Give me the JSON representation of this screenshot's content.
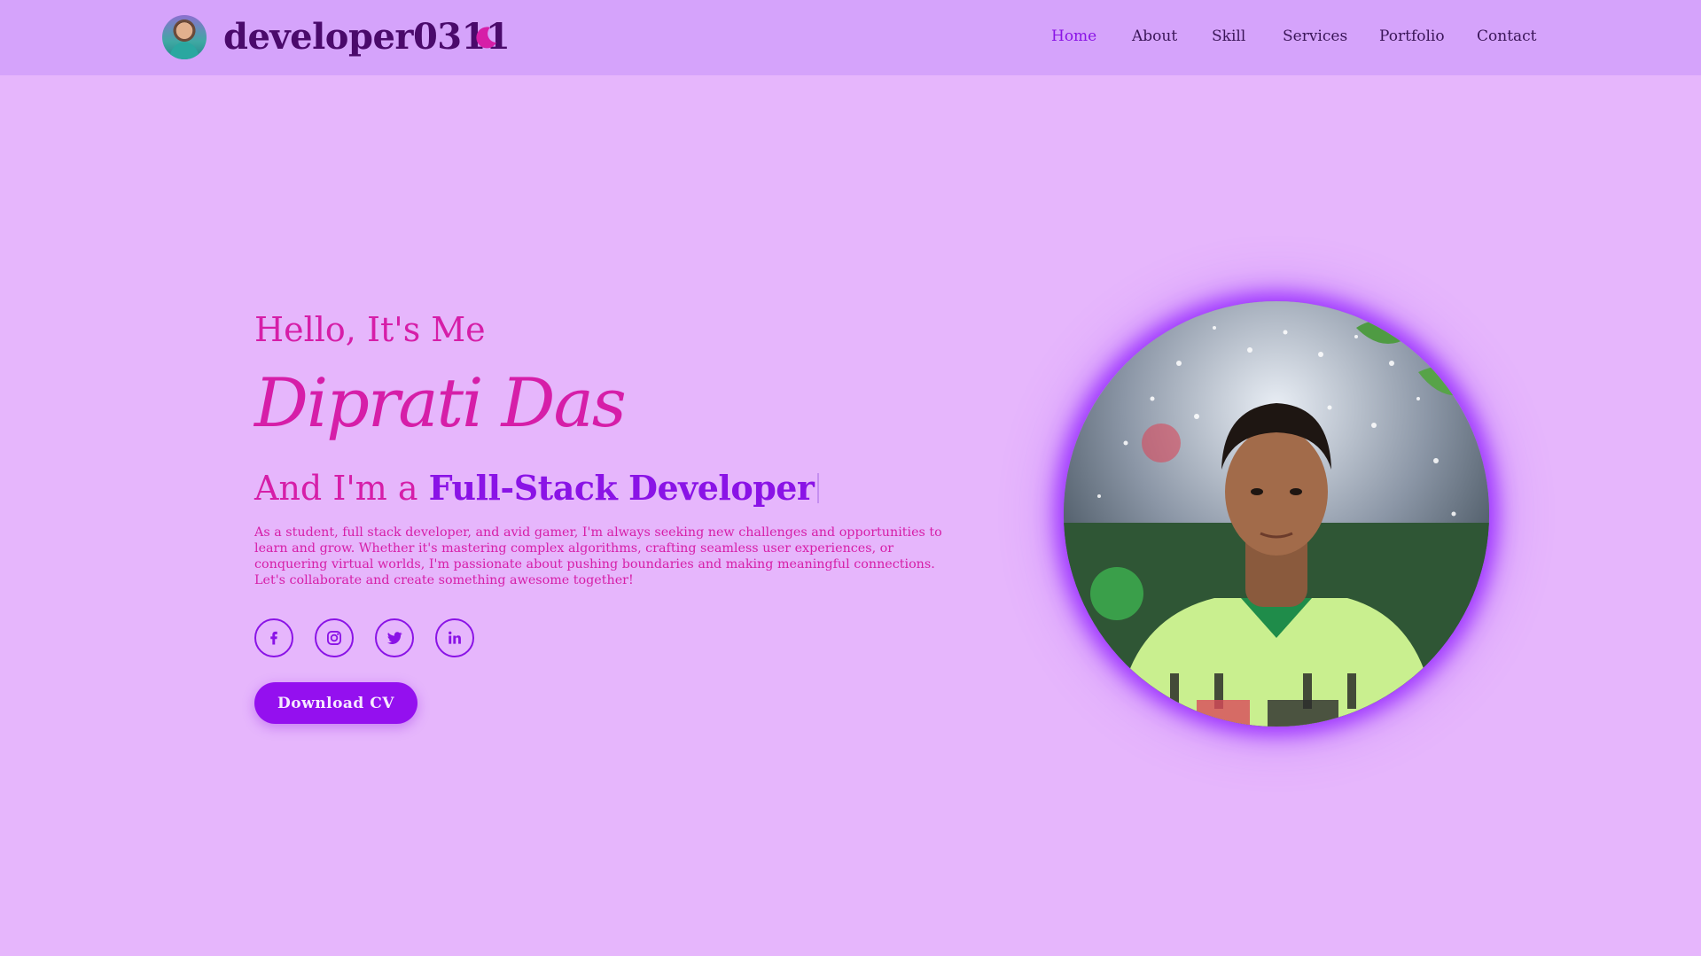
{
  "header": {
    "logo_text": "developer0311",
    "avatar_icon": "profile-avatar",
    "theme_icon": "moon-icon",
    "nav": [
      {
        "label": "Home",
        "active": true
      },
      {
        "label": "About",
        "active": false
      },
      {
        "label": "Skill",
        "active": false
      },
      {
        "label": "Services",
        "active": false
      },
      {
        "label": "Portfolio",
        "active": false
      },
      {
        "label": "Contact",
        "active": false
      }
    ]
  },
  "hero": {
    "greeting": "Hello, It's Me",
    "name": "Diprati Das",
    "role_prefix": "And I'm a ",
    "role_typed": "Full-Stack Developer",
    "description": "As a student, full stack developer, and avid gamer, I'm always seeking new challenges and opportunities to learn and grow. Whether it's mastering complex algorithms, crafting seamless user experiences, or conquering virtual worlds, I'm passionate about pushing boundaries and making meaningful connections. Let's collaborate and create something awesome together!",
    "socials": [
      "facebook-icon",
      "instagram-icon",
      "twitter-icon",
      "linkedin-icon"
    ],
    "cv_button": "Download CV",
    "photo": "profile-photo"
  },
  "colors": {
    "background": "#e6b6fc",
    "header_bg": "#d5a3fb",
    "accent_pink": "#d61ea8",
    "accent_purple": "#8a13e6",
    "logo_text": "#4a0a6b"
  }
}
